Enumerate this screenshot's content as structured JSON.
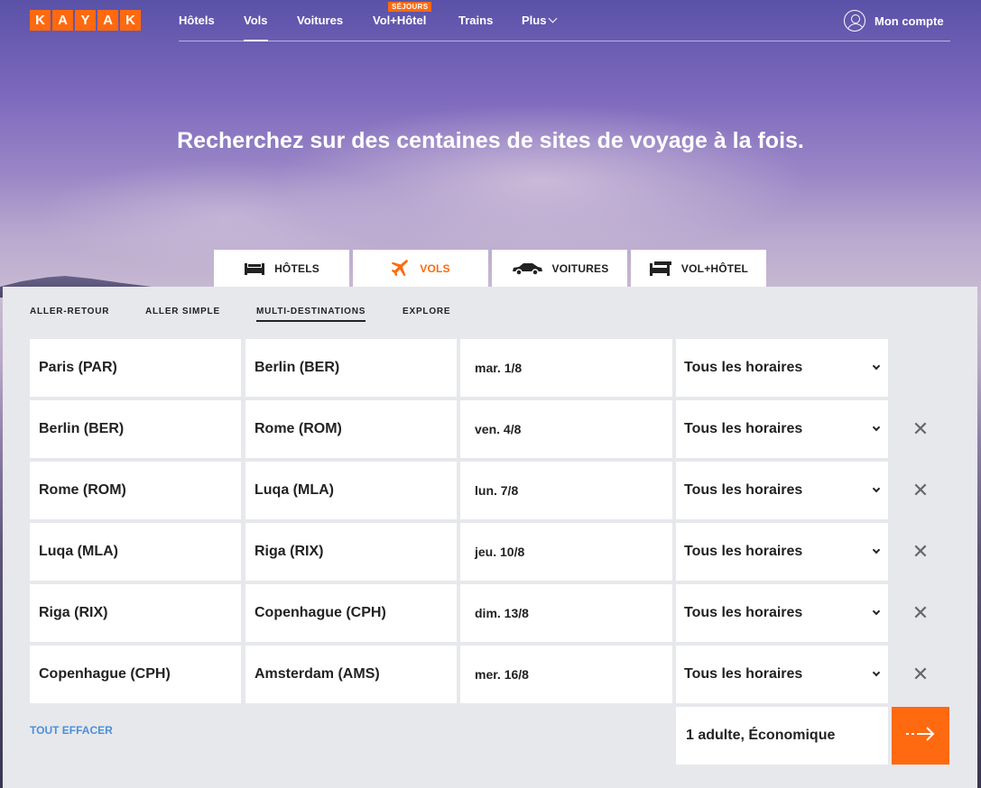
{
  "logo": [
    "K",
    "A",
    "Y",
    "A",
    "K"
  ],
  "nav": {
    "items": [
      {
        "label": "Hôtels"
      },
      {
        "label": "Vols"
      },
      {
        "label": "Voitures"
      },
      {
        "label": "Vol+Hôtel"
      },
      {
        "label": "Trains"
      },
      {
        "label": "Plus"
      }
    ],
    "badge": "SÉJOURS",
    "account": "Mon compte"
  },
  "headline": "Recherchez sur des centaines de sites de voyage à la fois.",
  "vertical_tabs": [
    {
      "label": "HÔTELS",
      "icon": "bed-icon"
    },
    {
      "label": "VOLS",
      "icon": "plane-icon"
    },
    {
      "label": "VOITURES",
      "icon": "car-icon"
    },
    {
      "label": "VOL+HÔTEL",
      "icon": "package-icon"
    }
  ],
  "trip_types": [
    "ALLER-RETOUR",
    "ALLER SIMPLE",
    "MULTI-DESTINATIONS",
    "EXPLORE"
  ],
  "legs": [
    {
      "origin": "Paris (PAR)",
      "destination": "Berlin (BER)",
      "date": "mar. 1/8",
      "time": "Tous les horaires"
    },
    {
      "origin": "Berlin (BER)",
      "destination": "Rome (ROM)",
      "date": "ven. 4/8",
      "time": "Tous les horaires"
    },
    {
      "origin": "Rome (ROM)",
      "destination": "Luqa (MLA)",
      "date": "lun. 7/8",
      "time": "Tous les horaires"
    },
    {
      "origin": "Luqa (MLA)",
      "destination": "Riga (RIX)",
      "date": "jeu. 10/8",
      "time": "Tous les horaires"
    },
    {
      "origin": "Riga (RIX)",
      "destination": "Copenhague (CPH)",
      "date": "dim. 13/8",
      "time": "Tous les horaires"
    },
    {
      "origin": "Copenhague (CPH)",
      "destination": "Amsterdam (AMS)",
      "date": "mer. 16/8",
      "time": "Tous les horaires"
    }
  ],
  "clear_all": "TOUT EFFACER",
  "travelers": "1 adulte, Économique",
  "colors": {
    "brand": "#ff690f",
    "link": "#4a90d9"
  }
}
